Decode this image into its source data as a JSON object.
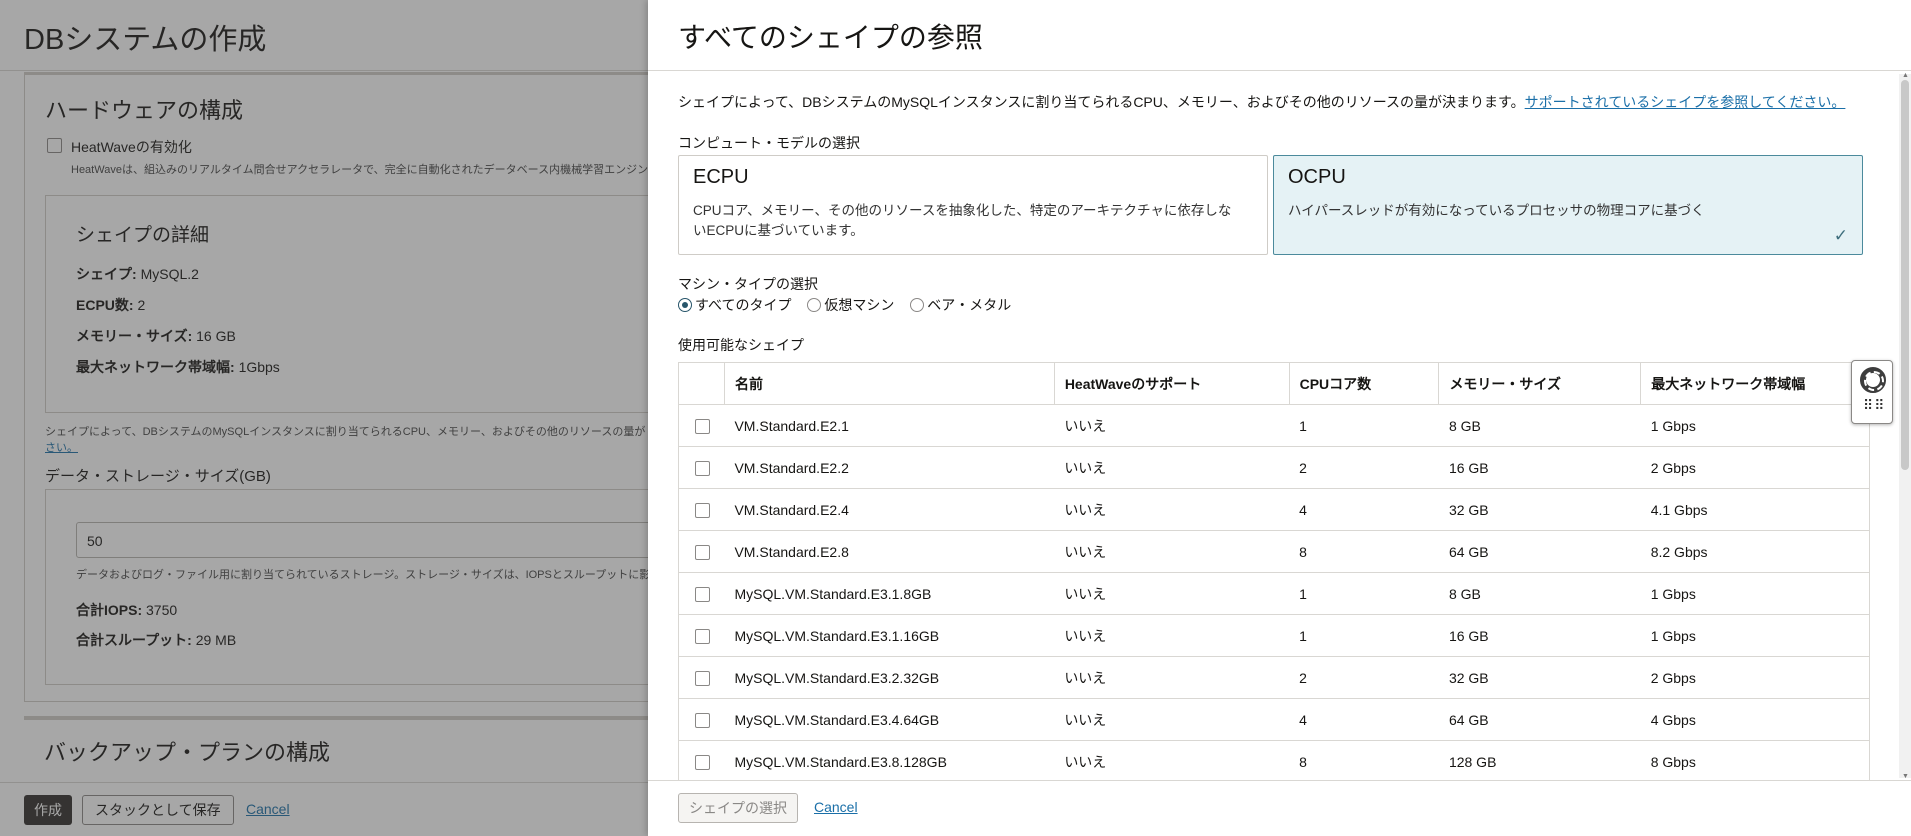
{
  "background": {
    "page_title": "DBシステムの作成",
    "hardware_section_title": "ハードウェアの構成",
    "heatwave_label": "HeatWaveの有効化",
    "heatwave_help": "HeatWaveは、組込みのリアルタイム問合せアクセラレータで、完全に自動化されたデータベース内機械学習エンジン",
    "shape_details_title": "シェイプの詳細",
    "shape_label": "シェイプ:",
    "shape_value": "MySQL.2",
    "ecpu_label": "ECPU数:",
    "ecpu_value": "2",
    "memory_label": "メモリー・サイズ:",
    "memory_value": "16 GB",
    "network_label": "最大ネットワーク帯域幅:",
    "network_value": "1Gbps",
    "shape_note": "シェイプによって、DBシステムのMySQLインスタンスに割り当てられるCPU、メモリー、およびその他のリソースの量が",
    "shape_note_link": "さい。",
    "storage_label": "データ・ストレージ・サイズ(GB)",
    "storage_value": "50",
    "storage_help": "データおよびログ・ファイル用に割り当てられているストレージ。ストレージ・サイズは、IOPSとスループットに影",
    "iops_label": "合計IOPS:",
    "iops_value": "3750",
    "throughput_label": "合計スループット:",
    "throughput_value": "29 MB",
    "backup_title": "バックアップ・プランの構成",
    "create_button": "作成",
    "save_stack_button": "スタックとして保存",
    "cancel_link": "Cancel"
  },
  "drawer": {
    "title": "すべてのシェイプの参照",
    "intro_text": "シェイプによって、DBシステムのMySQLインスタンスに割り当てられるCPU、メモリー、およびその他のリソースの量が決まります。",
    "intro_link": "サポートされているシェイプを参照してください。",
    "compute_model_label": "コンピュート・モデルの選択",
    "models": [
      {
        "title": "ECPU",
        "desc": "CPUコア、メモリー、その他のリソースを抽象化した、特定のアーキテクチャに依存しないECPUに基づいています。"
      },
      {
        "title": "OCPU",
        "desc": "ハイパースレッドが有効になっているプロセッサの物理コアに基づく",
        "check": "✓"
      }
    ],
    "machine_type_label": "マシン・タイプの選択",
    "machine_types": [
      "すべてのタイプ",
      "仮想マシン",
      "ベア・メタル"
    ],
    "available_shapes_label": "使用可能なシェイプ",
    "columns": [
      "名前",
      "HeatWaveのサポート",
      "CPUコア数",
      "メモリー・サイズ",
      "最大ネットワーク帯域幅"
    ],
    "rows": [
      [
        "VM.Standard.E2.1",
        "いいえ",
        "1",
        "8 GB",
        "1 Gbps"
      ],
      [
        "VM.Standard.E2.2",
        "いいえ",
        "2",
        "16 GB",
        "2 Gbps"
      ],
      [
        "VM.Standard.E2.4",
        "いいえ",
        "4",
        "32 GB",
        "4.1 Gbps"
      ],
      [
        "VM.Standard.E2.8",
        "いいえ",
        "8",
        "64 GB",
        "8.2 Gbps"
      ],
      [
        "MySQL.VM.Standard.E3.1.8GB",
        "いいえ",
        "1",
        "8 GB",
        "1 Gbps"
      ],
      [
        "MySQL.VM.Standard.E3.1.16GB",
        "いいえ",
        "1",
        "16 GB",
        "1 Gbps"
      ],
      [
        "MySQL.VM.Standard.E3.2.32GB",
        "いいえ",
        "2",
        "32 GB",
        "2 Gbps"
      ],
      [
        "MySQL.VM.Standard.E3.4.64GB",
        "いいえ",
        "4",
        "64 GB",
        "4 Gbps"
      ],
      [
        "MySQL.VM.Standard.E3.8.128GB",
        "いいえ",
        "8",
        "128 GB",
        "8 Gbps"
      ]
    ],
    "select_button": "シェイプの選択",
    "cancel_link": "Cancel"
  }
}
